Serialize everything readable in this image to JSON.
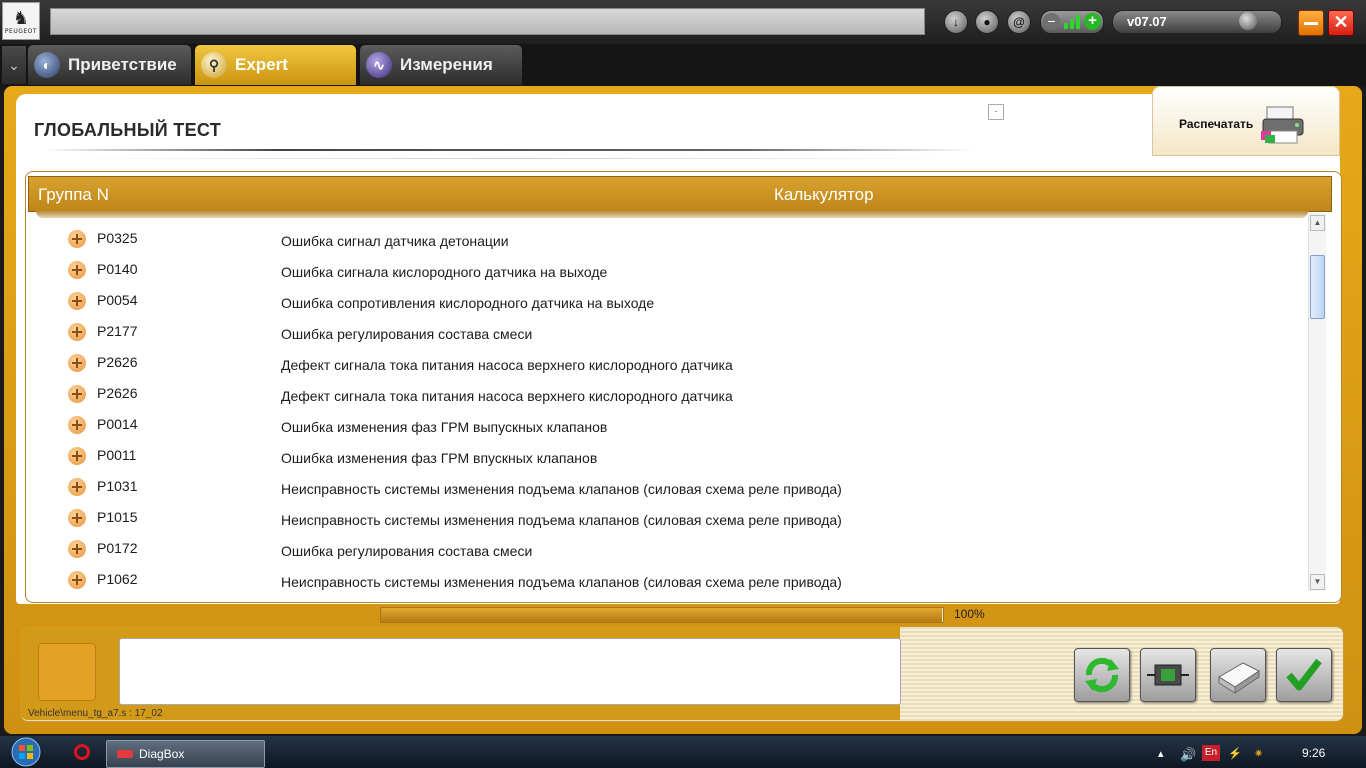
{
  "window": {
    "logo_text": "PEUGEOT",
    "version": "v07.07"
  },
  "tabs": [
    {
      "label": "Приветствие",
      "active": false
    },
    {
      "label": "Expert",
      "active": true
    },
    {
      "label": "Измерения",
      "active": false
    }
  ],
  "page": {
    "title": "ГЛОБАЛЬНЫЙ ТЕСТ",
    "print_label": "Распечатать"
  },
  "table": {
    "columns": [
      "Группа N",
      "Калькулятор"
    ],
    "rows": [
      {
        "code": "P0325",
        "description": "Ошибка сигнал датчика детонации"
      },
      {
        "code": "P0140",
        "description": "Ошибка сигнала кислородного датчика на выходе"
      },
      {
        "code": "P0054",
        "description": "Ошибка сопротивления кислородного датчика на выходе"
      },
      {
        "code": "P2177",
        "description": "Ошибка регулирования состава смеси"
      },
      {
        "code": "P2626",
        "description": "Дефект сигнала тока питания насоса верхнего кислородного датчика"
      },
      {
        "code": "P2626",
        "description": "Дефект сигнала тока питания насоса верхнего кислородного датчика"
      },
      {
        "code": "P0014",
        "description": "Ошибка изменения фаз ГРМ выпускных клапанов"
      },
      {
        "code": "P0011",
        "description": "Ошибка изменения фаз ГРМ впускных клапанов"
      },
      {
        "code": "P1031",
        "description": "Неисправность системы изменения подъема клапанов (силовая схема реле привода)"
      },
      {
        "code": "P1015",
        "description": "Неисправность системы изменения подъема клапанов (силовая схема реле привода)"
      },
      {
        "code": "P0172",
        "description": "Ошибка регулирования состава смеси"
      },
      {
        "code": "P1062",
        "description": "Неисправность системы изменения подъема клапанов (силовая схема реле привода)"
      }
    ]
  },
  "progress": {
    "value": 1.0,
    "label": "100%"
  },
  "status": {
    "path": "Vehicle\\menu_tg_a7.s : 17_02",
    "message": ""
  },
  "taskbar": {
    "app_label": "DiagBox",
    "lang": "En",
    "clock": "9:26"
  },
  "colors": {
    "accent": "#d39a1a",
    "header": "#c8901f",
    "progress": "#c8901f"
  }
}
